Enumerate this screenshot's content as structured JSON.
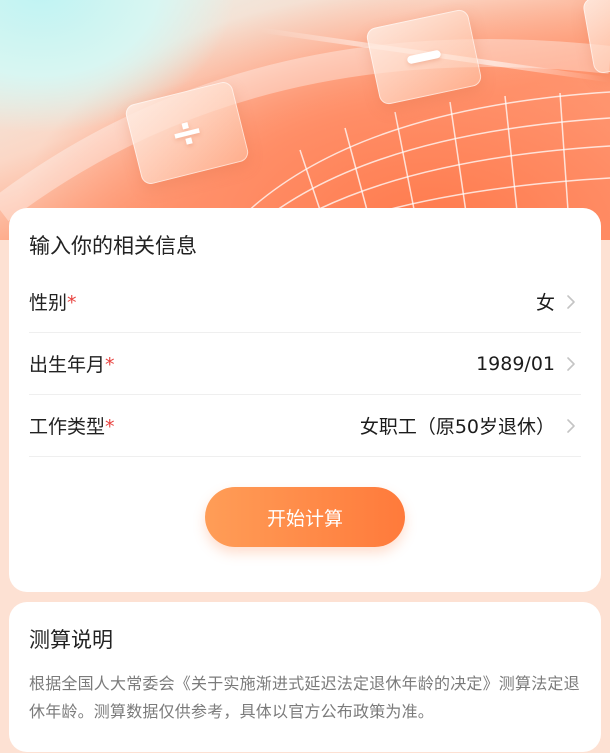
{
  "hero": {
    "tiles": [
      {
        "name": "divide-tile",
        "icon": "divide-icon",
        "symbol": "÷"
      },
      {
        "name": "minus-tile",
        "icon": "minus-icon",
        "symbol": "−"
      }
    ]
  },
  "form": {
    "title": "输入你的相关信息",
    "required_mark": "*",
    "rows": [
      {
        "label": "性别",
        "value": "女"
      },
      {
        "label": "出生年月",
        "value": "1989/01"
      },
      {
        "label": "工作类型",
        "value": "女职工（原50岁退休）"
      }
    ],
    "submit_label": "开始计算"
  },
  "description": {
    "title": "测算说明",
    "text": "根据全国人大常委会《关于实施渐进式延迟法定退休年龄的决定》测算法定退休年龄。测算数据仅供参考，具体以官方公布政策为准。"
  },
  "colors": {
    "accent_start": "#ff9d57",
    "accent_end": "#ff7a3b",
    "required": "#e8423f"
  }
}
